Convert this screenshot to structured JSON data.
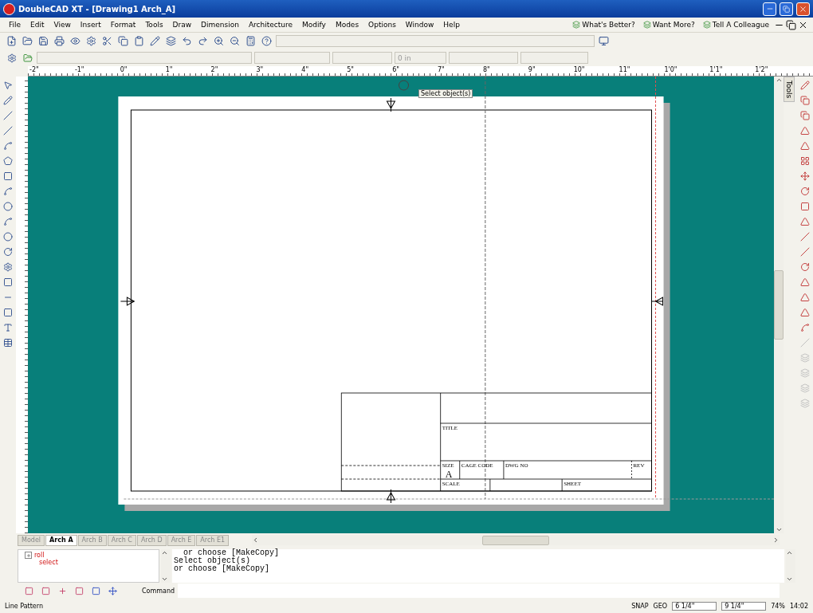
{
  "window": {
    "title": "DoubleCAD XT - [Drawing1 Arch_A]"
  },
  "menu": [
    "File",
    "Edit",
    "View",
    "Insert",
    "Format",
    "Tools",
    "Draw",
    "Dimension",
    "Architecture",
    "Modify",
    "Modes",
    "Options",
    "Window",
    "Help"
  ],
  "promos": [
    "What's Better?",
    "Want More?",
    "Tell A Colleague"
  ],
  "toolbar": {
    "units_field": "0 in"
  },
  "ruler": {
    "labels": [
      "-2\"",
      "-1\"",
      "0\"",
      "1\"",
      "2\"",
      "3\"",
      "4\"",
      "5\"",
      "6\"",
      "7\"",
      "8\"",
      "9\"",
      "10\"",
      "11\"",
      "1'0\"",
      "1'1\"",
      "1'2\""
    ]
  },
  "canvas": {
    "tooltip": "Select object(s)",
    "title_block": {
      "title": "TITLE",
      "size": "SIZE",
      "size_value": "A",
      "cage_code": "CAGE CODE",
      "dwg_no": "DWG NO",
      "rev": "REV",
      "scale": "SCALE",
      "sheet": "SHEET"
    }
  },
  "side_tab": "Tools",
  "sheet_tabs": [
    {
      "label": "Model",
      "selected": false
    },
    {
      "label": "Arch A",
      "selected": true
    },
    {
      "label": "Arch B",
      "selected": false
    },
    {
      "label": "Arch C",
      "selected": false
    },
    {
      "label": "Arch D",
      "selected": false
    },
    {
      "label": "Arch E",
      "selected": false
    },
    {
      "label": "Arch E1",
      "selected": false
    }
  ],
  "tree": [
    {
      "label": "roll",
      "kind": "group",
      "expanded": false
    },
    {
      "label": "select",
      "kind": "leaf"
    }
  ],
  "command_history": [
    "  or choose [MakeCopy]",
    "Select object(s)",
    "or choose [MakeCopy]"
  ],
  "command": {
    "label": "Command"
  },
  "status": {
    "message": "Line Pattern",
    "snap": "SNAP",
    "geo": "GEO",
    "x": "6 1/4\"",
    "y": "9 1/4\"",
    "zoom": "74%",
    "time": "14:02"
  }
}
